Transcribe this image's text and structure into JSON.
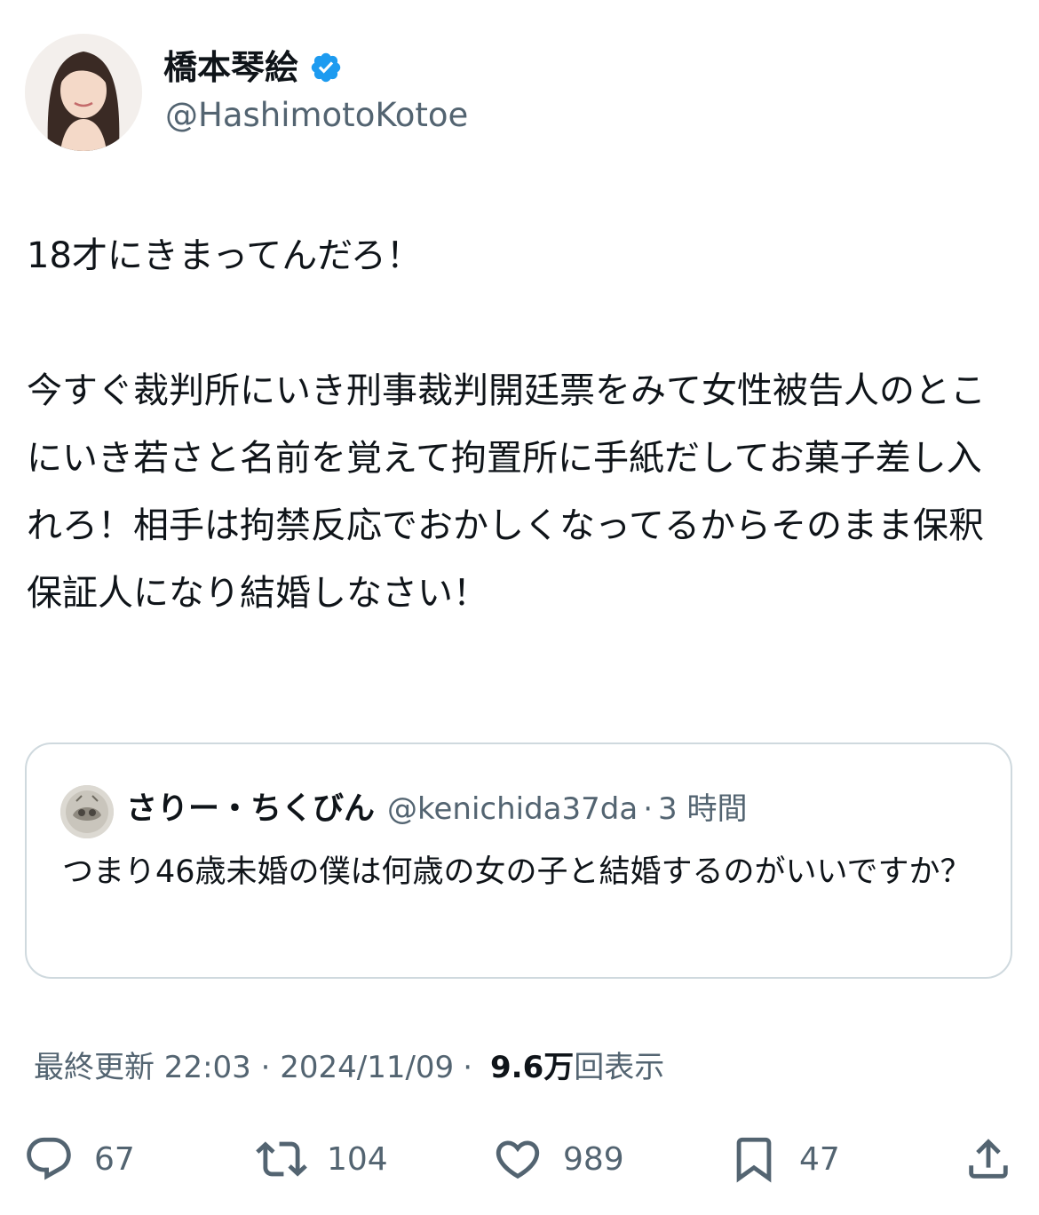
{
  "author": {
    "name": "橋本琴絵",
    "handle": "@HashimotoKotoe",
    "avatar_icon": "profile-photo-avatar",
    "verified_icon": "verified-badge-icon",
    "verified_color": "#1d9bf0"
  },
  "tweet": {
    "text": "18才にきまってんだろ！\n\n今すぐ裁判所にいき刑事裁判開廷票をみて女性被告人のとこにいき若さと名前を覚えて拘置所に手紙だしてお菓子差し入れろ！相手は拘禁反応でおかしくなってるからそのまま保釈保証人になり結婚しなさい！"
  },
  "quote": {
    "name": "さりー・ちくびん",
    "handle": "@kenichida37da",
    "separator": "·",
    "time": "3 時間",
    "text": "つまり46歳未婚の僕は何歳の女の子と結婚するのがいいですか？"
  },
  "meta": {
    "updated": "最終更新 22:03 · 2024/11/09",
    "dot": "·",
    "views_count": "9.6万",
    "views_label": "回表示"
  },
  "actions": {
    "replies": "67",
    "retweets": "104",
    "likes": "989",
    "bookmarks": "47",
    "reply_icon": "reply-icon",
    "retweet_icon": "retweet-icon",
    "like_icon": "heart-icon",
    "bookmark_icon": "bookmark-icon",
    "share_icon": "share-icon"
  },
  "colors": {
    "text": "#0f1419",
    "secondary": "#536471",
    "border": "#cfd9de"
  }
}
